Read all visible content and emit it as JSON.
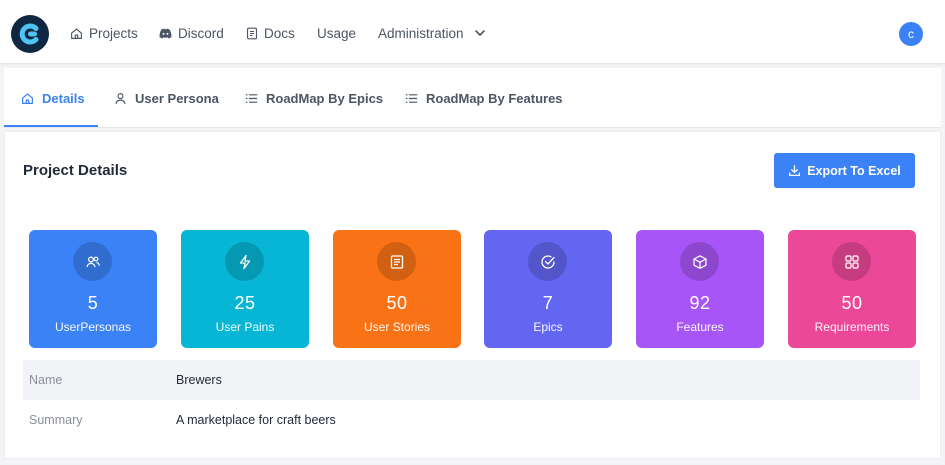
{
  "nav": {
    "items": [
      {
        "label": "Projects",
        "icon": "home-icon"
      },
      {
        "label": "Discord",
        "icon": "discord-icon"
      },
      {
        "label": "Docs",
        "icon": "document-icon"
      },
      {
        "label": "Usage"
      },
      {
        "label": "Administration",
        "icon": "chevron-down-icon"
      }
    ],
    "avatar_initial": "c"
  },
  "tabs": [
    {
      "label": "Details",
      "icon": "home-icon",
      "active": true
    },
    {
      "label": "User Persona",
      "icon": "user-icon"
    },
    {
      "label": "RoadMap By Epics",
      "icon": "list-icon"
    },
    {
      "label": "RoadMap By Features",
      "icon": "list-icon"
    }
  ],
  "panel": {
    "title": "Project Details",
    "export_label": "Export To Excel"
  },
  "stats": [
    {
      "value": "5",
      "label": "UserPersonas",
      "color": "#3b82f6",
      "icon": "users-icon"
    },
    {
      "value": "25",
      "label": "User Pains",
      "color": "#06b6d4",
      "icon": "lightning-icon"
    },
    {
      "value": "50",
      "label": "User Stories",
      "color": "#f97316",
      "icon": "book-icon"
    },
    {
      "value": "7",
      "label": "Epics",
      "color": "#6366f1",
      "icon": "check-circle-icon"
    },
    {
      "value": "92",
      "label": "Features",
      "color": "#a855f7",
      "icon": "box-icon"
    },
    {
      "value": "50",
      "label": "Requirements",
      "color": "#ec4899",
      "icon": "grid-icon"
    }
  ],
  "details": [
    {
      "key": "Name",
      "value": "Brewers"
    },
    {
      "key": "Summary",
      "value": "A marketplace for craft beers"
    }
  ]
}
